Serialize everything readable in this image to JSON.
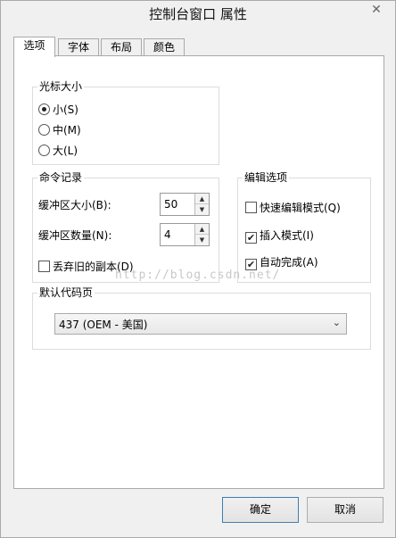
{
  "window": {
    "title": "控制台窗口 属性",
    "close_glyph": "✕"
  },
  "tabs": [
    {
      "label": "选项",
      "active": true
    },
    {
      "label": "字体",
      "active": false
    },
    {
      "label": "布局",
      "active": false
    },
    {
      "label": "颜色",
      "active": false
    }
  ],
  "cursor_size": {
    "legend": "光标大小",
    "options": [
      {
        "label": "小(S)",
        "selected": true
      },
      {
        "label": "中(M)",
        "selected": false
      },
      {
        "label": "大(L)",
        "selected": false
      }
    ]
  },
  "history": {
    "legend": "命令记录",
    "buffer_size_label": "缓冲区大小(B):",
    "buffer_size_value": "50",
    "buffer_count_label": "缓冲区数量(N):",
    "buffer_count_value": "4",
    "discard_label": "丢弃旧的副本(D)",
    "discard_checked": false
  },
  "edit_options": {
    "legend": "编辑选项",
    "items": [
      {
        "label": "快速编辑模式(Q)",
        "checked": false
      },
      {
        "label": "插入模式(I)",
        "checked": true
      },
      {
        "label": "自动完成(A)",
        "checked": true
      }
    ]
  },
  "codepage": {
    "legend": "默认代码页",
    "selected": "437   (OEM - 美国)"
  },
  "watermark": "http://blog.csdn.net/",
  "buttons": {
    "ok": "确定",
    "cancel": "取消"
  },
  "icons": {
    "check_glyph": "✔",
    "up_glyph": "▲",
    "down_glyph": "▼",
    "dropdown_glyph": "⌄"
  }
}
